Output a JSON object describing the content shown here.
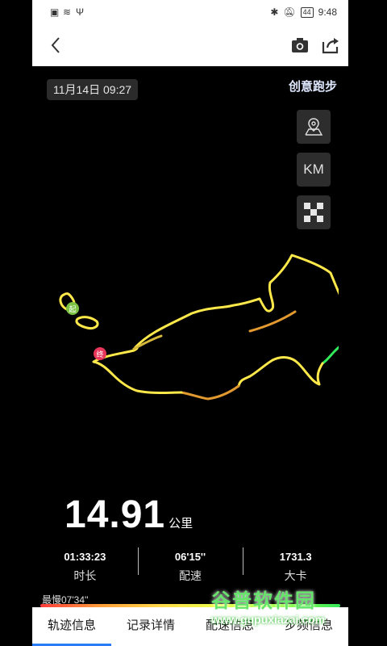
{
  "status_bar": {
    "battery": "44",
    "time": "9:48"
  },
  "header": {
    "back_icon": "back-arrow-icon",
    "camera_icon": "camera-icon",
    "share_icon": "share-icon"
  },
  "map": {
    "date": "11月14日 09:27",
    "mode": "创意跑步",
    "buttons": {
      "map_type_icon": "map-pin-icon",
      "unit": "KM",
      "grid_icon": "checker-icon"
    },
    "markers": {
      "start": "起",
      "end": "终"
    }
  },
  "summary": {
    "distance_value": "14.91",
    "distance_unit": "公里"
  },
  "stats": [
    {
      "value": "01:33:23",
      "label": "时长"
    },
    {
      "value": "06'15''",
      "label": "配速"
    },
    {
      "value": "1731.3",
      "label": "大卡"
    }
  ],
  "pace_legend": {
    "slowest": "最慢07'34''"
  },
  "tabs": [
    {
      "label": "轨迹信息",
      "active": true
    },
    {
      "label": "记录详情"
    },
    {
      "label": "配速信息"
    },
    {
      "label": "步频信息"
    }
  ],
  "watermark": {
    "brand": "谷普软件园",
    "url": "www.gupuxiazai.com"
  },
  "colors": {
    "track_fast": "#32e95b",
    "track_mid": "#ffe84a",
    "track_slow": "#e2992f",
    "tab_active": "#2a7cf6"
  }
}
